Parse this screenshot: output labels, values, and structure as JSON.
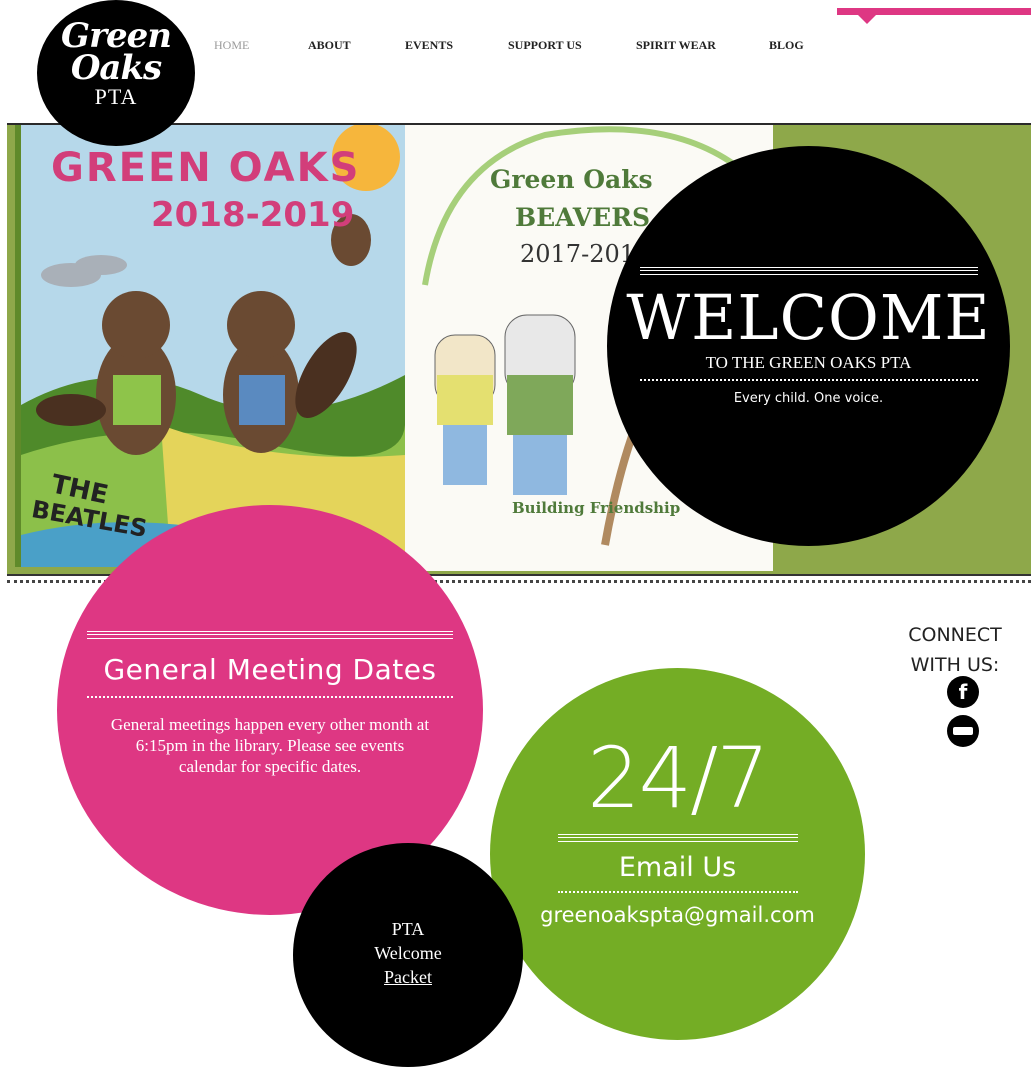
{
  "logo": {
    "line1": "Green",
    "line2": "Oaks",
    "line3": "PTA"
  },
  "nav": {
    "items": [
      {
        "label": "HOME",
        "active": true
      },
      {
        "label": "ABOUT",
        "active": false
      },
      {
        "label": "EVENTS",
        "active": false
      },
      {
        "label": "SUPPORT US",
        "active": false
      },
      {
        "label": "SPIRIT WEAR",
        "active": false
      },
      {
        "label": "BLOG",
        "active": false
      }
    ]
  },
  "hero": {
    "art_left": {
      "title": "GREEN OAKS",
      "years": "2018-2019",
      "caption_1": "THE",
      "caption_2": "BEATLES"
    },
    "art_right": {
      "title_1": "Green Oaks",
      "title_2": "BEAVERS",
      "years": "2017-2018",
      "caption": "Building Friendship"
    },
    "welcome": {
      "title": "WELCOME",
      "subtitle": "TO THE GREEN OAKS PTA",
      "tagline": "Every child. One voice."
    }
  },
  "meetings": {
    "title": "General Meeting Dates",
    "body": "General meetings happen every other month at 6:15pm in the library. Please see events calendar for specific dates."
  },
  "contact": {
    "big": "24/7",
    "title": "Email Us",
    "email": "greenoakspta@gmail.com"
  },
  "packet": {
    "line1": "PTA",
    "line2": "Welcome",
    "link": "Packet"
  },
  "connect": {
    "line1": "CONNECT",
    "line2": "WITH US:",
    "icons": [
      "facebook-icon",
      "flickr-icon"
    ]
  },
  "colors": {
    "pink": "#de3783",
    "green": "#74ad25",
    "olive": "#8ea84a",
    "black": "#000000"
  }
}
